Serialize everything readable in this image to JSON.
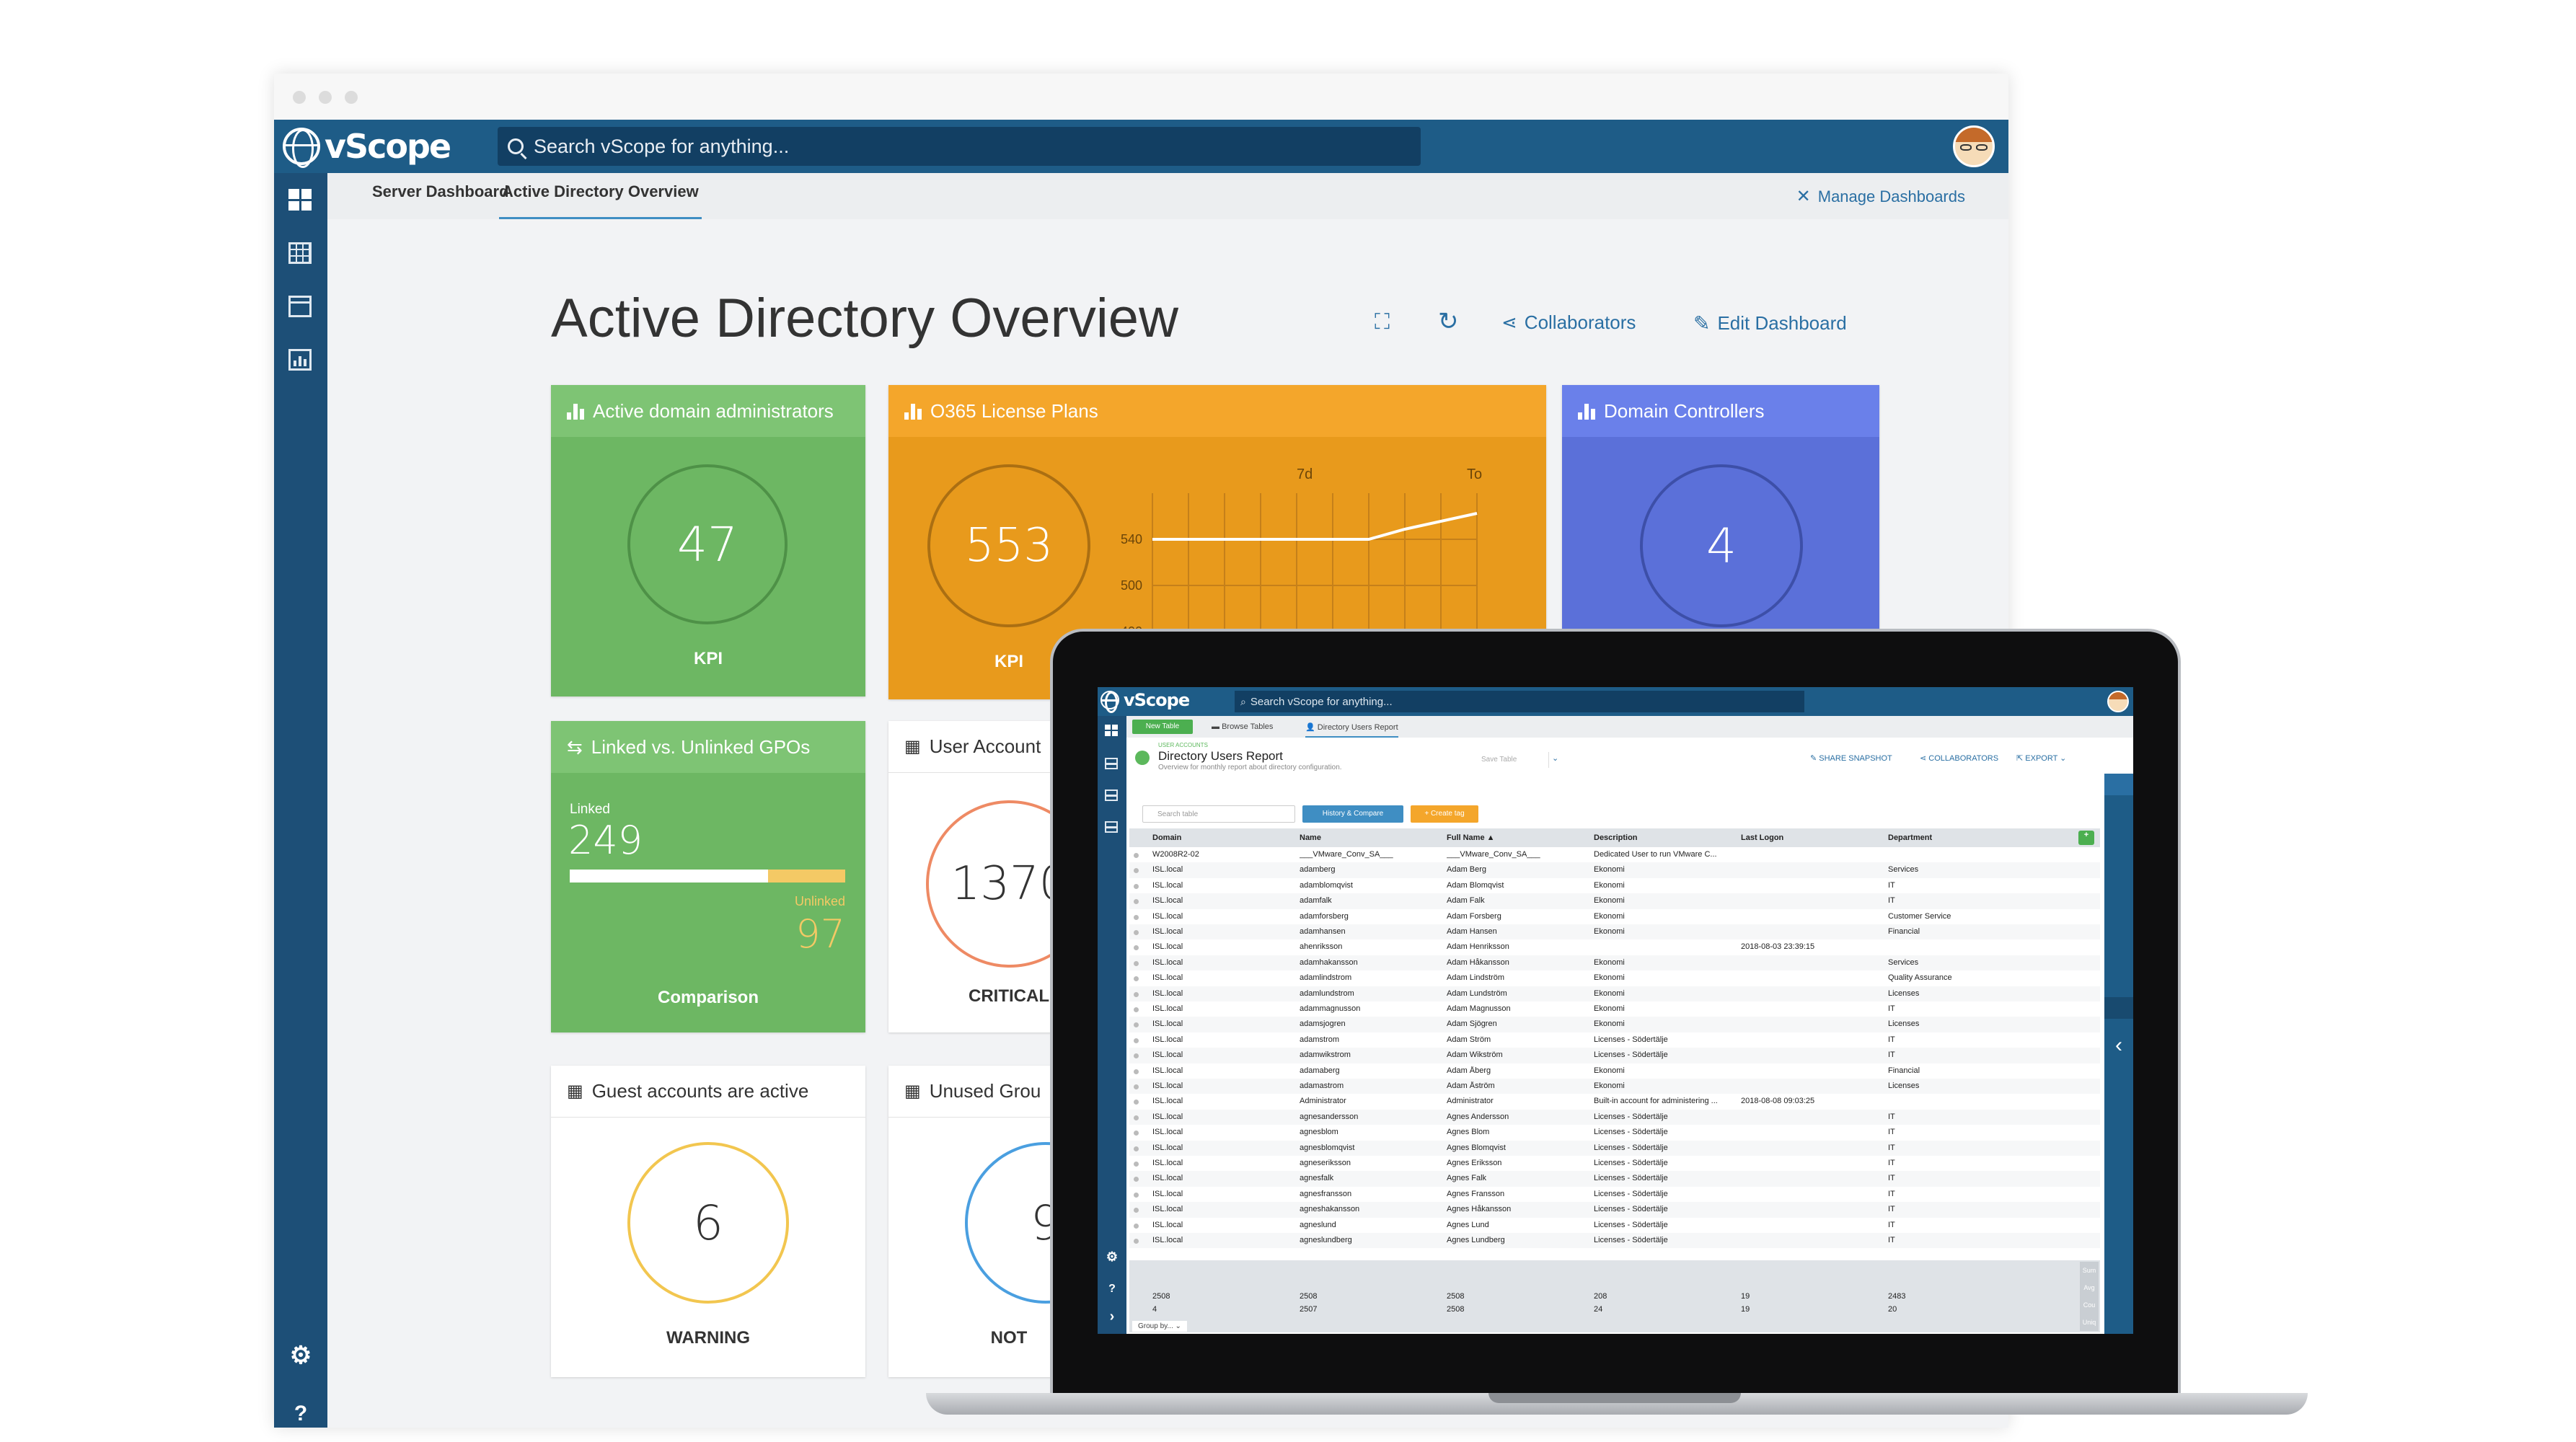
{
  "app": {
    "logo_text": "vScope",
    "search_placeholder": "Search vScope for anything..."
  },
  "tabs": [
    {
      "label": "Server Dashboard"
    },
    {
      "label": "Active Directory Overview"
    }
  ],
  "manage_dashboards": "Manage Dashboards",
  "page_title": "Active Directory Overview",
  "toolbar": {
    "collaborators": "Collaborators",
    "edit_dashboard": "Edit Dashboard"
  },
  "colors": {
    "topbar": "#1e5c87",
    "sidebar": "#1d4f77",
    "green": "#6db763",
    "orange": "#e89a1c",
    "blue": "#5b70d9",
    "critical": "#ee8a64",
    "warning": "#f2c64f",
    "notice": "#4a9fe0"
  },
  "cards": {
    "admins": {
      "title": "Active domain administrators",
      "value": "47",
      "caption": "KPI"
    },
    "o365": {
      "title": "O365 License Plans",
      "value": "553",
      "caption": "KPI",
      "chart_labels": {
        "left": "7d",
        "right": "To"
      },
      "y_ticks": [
        "540",
        "500",
        "400"
      ]
    },
    "dc": {
      "title": "Domain Controllers",
      "value": "4"
    },
    "gpo": {
      "title": "Linked vs. Unlinked GPOs",
      "linked_label": "Linked",
      "linked_value": "249",
      "unlinked_label": "Unlinked",
      "unlinked_value": "97",
      "caption": "Comparison",
      "linked_fraction": 0.72
    },
    "user_accounts": {
      "title": "User Account",
      "value": "1370",
      "caption": "CRITICAL"
    },
    "guest": {
      "title": "Guest accounts are active",
      "value": "6",
      "caption": "WARNING"
    },
    "unused": {
      "title": "Unused Grou",
      "value": "9",
      "caption": "NOT"
    }
  },
  "laptop": {
    "tabs": {
      "new_table": "New Table",
      "browse": "Browse Tables",
      "report": "Directory Users Report"
    },
    "section_label": "USER ACCOUNTS",
    "report_title": "Directory Users Report",
    "report_subtitle": "Overview for monthly report about directory configuration.",
    "save_table": "Save Table",
    "share_snapshot": "SHARE SNAPSHOT",
    "collaborators": "COLLABORATORS",
    "export": "EXPORT",
    "search_table": "Search table",
    "history_compare": "History & Compare",
    "create_tag": "+ Create tag",
    "columns": [
      "Domain",
      "Name",
      "Full Name ▲",
      "Description",
      "Last Logon",
      "Department"
    ],
    "rows": [
      [
        "W2008R2-02",
        "___VMware_Conv_SA___",
        "___VMware_Conv_SA___",
        "Dedicated User to run VMware C...",
        "",
        ""
      ],
      [
        "ISL.local",
        "adamberg",
        "Adam Berg",
        "Ekonomi",
        "",
        "Services"
      ],
      [
        "ISL.local",
        "adamblomqvist",
        "Adam Blomqvist",
        "Ekonomi",
        "",
        "IT"
      ],
      [
        "ISL.local",
        "adamfalk",
        "Adam Falk",
        "Ekonomi",
        "",
        "IT"
      ],
      [
        "ISL.local",
        "adamforsberg",
        "Adam Forsberg",
        "Ekonomi",
        "",
        "Customer Service"
      ],
      [
        "ISL.local",
        "adamhansen",
        "Adam Hansen",
        "Ekonomi",
        "",
        "Financial"
      ],
      [
        "ISL.local",
        "ahenriksson",
        "Adam Henriksson",
        "",
        "2018-08-03 23:39:15",
        ""
      ],
      [
        "ISL.local",
        "adamhakansson",
        "Adam Håkansson",
        "Ekonomi",
        "",
        "Services"
      ],
      [
        "ISL.local",
        "adamlindstrom",
        "Adam Lindström",
        "Ekonomi",
        "",
        "Quality Assurance"
      ],
      [
        "ISL.local",
        "adamlundstrom",
        "Adam Lundström",
        "Ekonomi",
        "",
        "Licenses"
      ],
      [
        "ISL.local",
        "adammagnusson",
        "Adam Magnusson",
        "Ekonomi",
        "",
        "IT"
      ],
      [
        "ISL.local",
        "adamsjogren",
        "Adam Sjögren",
        "Ekonomi",
        "",
        "Licenses"
      ],
      [
        "ISL.local",
        "adamstrom",
        "Adam Ström",
        "Licenses - Södertälje",
        "",
        "IT"
      ],
      [
        "ISL.local",
        "adamwikstrom",
        "Adam Wikström",
        "Licenses - Södertälje",
        "",
        "IT"
      ],
      [
        "ISL.local",
        "adamaberg",
        "Adam Åberg",
        "Ekonomi",
        "",
        "Financial"
      ],
      [
        "ISL.local",
        "adamastrom",
        "Adam Åström",
        "Ekonomi",
        "",
        "Licenses"
      ],
      [
        "ISL.local",
        "Administrator",
        "Administrator",
        "Built-in account for administering ...",
        "2018-08-08 09:03:25",
        ""
      ],
      [
        "ISL.local",
        "agnesandersson",
        "Agnes Andersson",
        "Licenses - Södertälje",
        "",
        "IT"
      ],
      [
        "ISL.local",
        "agnesblom",
        "Agnes Blom",
        "Licenses - Södertälje",
        "",
        "IT"
      ],
      [
        "ISL.local",
        "agnesblomqvist",
        "Agnes Blomqvist",
        "Licenses - Södertälje",
        "",
        "IT"
      ],
      [
        "ISL.local",
        "agneseriksson",
        "Agnes Eriksson",
        "Licenses - Södertälje",
        "",
        "IT"
      ],
      [
        "ISL.local",
        "agnesfalk",
        "Agnes Falk",
        "Licenses - Södertälje",
        "",
        "IT"
      ],
      [
        "ISL.local",
        "agnesfransson",
        "Agnes Fransson",
        "Licenses - Södertälje",
        "",
        "IT"
      ],
      [
        "ISL.local",
        "agneshakansson",
        "Agnes Håkansson",
        "Licenses - Södertälje",
        "",
        "IT"
      ],
      [
        "ISL.local",
        "agneslund",
        "Agnes Lund",
        "Licenses - Södertälje",
        "",
        "IT"
      ],
      [
        "ISL.local",
        "agneslundberg",
        "Agnes Lundberg",
        "Licenses - Södertälje",
        "",
        "IT"
      ]
    ],
    "footer_rows": [
      [
        "2508",
        "2508",
        "2508",
        "208",
        "19",
        "2483"
      ],
      [
        "4",
        "2507",
        "2508",
        "24",
        "19",
        "20"
      ]
    ],
    "footer_labels": [
      "Sum",
      "Avg",
      "Cou",
      "Uniq"
    ],
    "group_by": "Group by..."
  }
}
